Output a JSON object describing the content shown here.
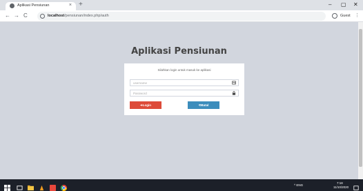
{
  "browser": {
    "tab_title": "Aplikasi Pensiunan",
    "tab_close": "×",
    "new_tab": "+",
    "url_host": "localhost",
    "url_path": "/pensiunan/index.php/auth",
    "profile_label": "Guest",
    "controls": {
      "minimize": "–",
      "maximize": "▢",
      "close": "✕"
    },
    "nav": {
      "back": "←",
      "forward": "→",
      "reload": "C"
    },
    "menu": "⋮"
  },
  "page": {
    "title": "Aplikasi Pensiunan",
    "login_message": "Silahkan login untuk masuk ke aplikasi",
    "username_placeholder": "username",
    "password_placeholder": "Password",
    "login_button": "Login",
    "batal_button": "Batal",
    "username_icon": "id-card-icon",
    "password_icon": "lock-icon"
  },
  "taskbar": {
    "tray_text": "^ ENG",
    "time": "7:18",
    "date": "11/10/2020"
  },
  "colors": {
    "page_bg": "#d2d6de",
    "login_btn": "#dd4b39",
    "batal_btn": "#3c8dbc",
    "taskbar": "#1c2029"
  }
}
